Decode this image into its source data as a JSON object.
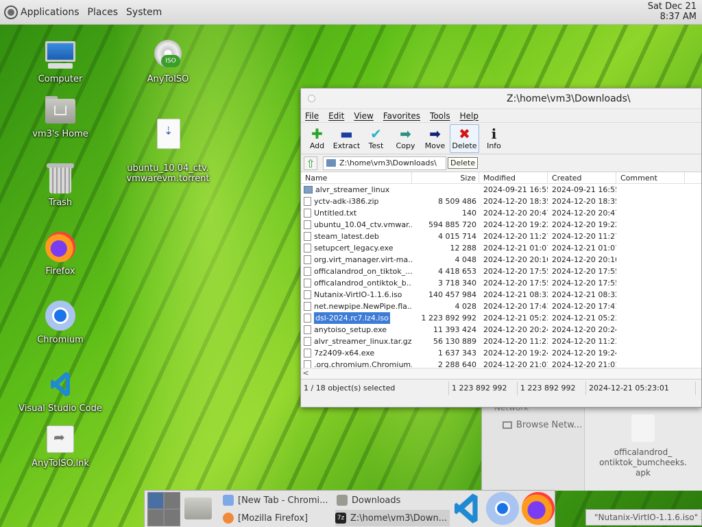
{
  "panel": {
    "menus": [
      "Applications",
      "Places",
      "System"
    ],
    "clock_date": "Sat Dec 21",
    "clock_time": "8:37 AM"
  },
  "desktop": {
    "icons": [
      {
        "label": "Computer",
        "icon": "computer-icon"
      },
      {
        "label": "vm3's Home",
        "icon": "home-folder-icon"
      },
      {
        "label": "Trash",
        "icon": "trash-icon"
      },
      {
        "label": "Firefox",
        "icon": "firefox-icon"
      },
      {
        "label": "Chromium",
        "icon": "chromium-icon"
      },
      {
        "label": "Visual Studio Code",
        "icon": "vscode-icon"
      },
      {
        "label": "AnyToISO.lnk",
        "icon": "shortcut-icon"
      },
      {
        "label": "AnyToISO",
        "icon": "iso-disc-icon"
      },
      {
        "label": "ubuntu_10.04_ctv.\nvmwarevm.torrent",
        "icon": "torrent-file-icon"
      }
    ]
  },
  "background_window": {
    "network_label": "Network",
    "browse_label": "Browse Netw...",
    "apk_label": "officalandrod_\nontiktok_bumcheeks.\napk"
  },
  "bottom_tooltip": "\"Nutanix-VirtIO-1.1.6.iso\" s",
  "file_manager": {
    "title": "Z:\\home\\vm3\\Downloads\\",
    "menu": [
      "File",
      "Edit",
      "View",
      "Favorites",
      "Tools",
      "Help"
    ],
    "toolbar": [
      {
        "label": "Add",
        "glyph": "✚"
      },
      {
        "label": "Extract",
        "glyph": "▬"
      },
      {
        "label": "Test",
        "glyph": "✔"
      },
      {
        "label": "Copy",
        "glyph": "➡"
      },
      {
        "label": "Move",
        "glyph": "➡"
      },
      {
        "label": "Delete",
        "glyph": "✖"
      },
      {
        "label": "Info",
        "glyph": "i"
      }
    ],
    "path": "Z:\\home\\vm3\\Downloads\\",
    "tooltip": "Delete",
    "columns": [
      "Name",
      "Size",
      "Modified",
      "Created",
      "Comment"
    ],
    "files": [
      {
        "name": "alvr_streamer_linux",
        "size": "",
        "modified": "2024-09-21 16:55",
        "created": "2024-09-21 16:55",
        "dir": true
      },
      {
        "name": "yctv-adk-i386.zip",
        "size": "8 509 486",
        "modified": "2024-12-20 18:35",
        "created": "2024-12-20 18:35"
      },
      {
        "name": "Untitled.txt",
        "size": "140",
        "modified": "2024-12-20 20:47",
        "created": "2024-12-20 20:47"
      },
      {
        "name": "ubuntu_10.04_ctv.vmwar...",
        "size": "594 885 720",
        "modified": "2024-12-20 19:22",
        "created": "2024-12-20 19:22"
      },
      {
        "name": "steam_latest.deb",
        "size": "4 015 714",
        "modified": "2024-12-20 11:27",
        "created": "2024-12-20 11:27"
      },
      {
        "name": "setupcert_legacy.exe",
        "size": "12 288",
        "modified": "2024-12-21 01:07",
        "created": "2024-12-21 01:07"
      },
      {
        "name": "org.virt_manager.virt-ma...",
        "size": "4 048",
        "modified": "2024-12-20 20:10",
        "created": "2024-12-20 20:10"
      },
      {
        "name": "officalandrod_on_tiktok_...",
        "size": "4 418 653",
        "modified": "2024-12-20 17:55",
        "created": "2024-12-20 17:55"
      },
      {
        "name": "officalandrod_ontiktok_b...",
        "size": "3 718 340",
        "modified": "2024-12-20 17:55",
        "created": "2024-12-20 17:55"
      },
      {
        "name": "Nutanix-VirtIO-1.1.6.iso",
        "size": "140 457 984",
        "modified": "2024-12-21 08:32",
        "created": "2024-12-21 08:32"
      },
      {
        "name": "net.newpipe.NewPipe.fla...",
        "size": "4 028",
        "modified": "2024-12-20 17:41",
        "created": "2024-12-20 17:41"
      },
      {
        "name": "dsl-2024.rc7.lz4.iso",
        "size": "1 223 892 992",
        "modified": "2024-12-21 05:23",
        "created": "2024-12-21 05:23",
        "selected": true
      },
      {
        "name": "anytoiso_setup.exe",
        "size": "11 393 424",
        "modified": "2024-12-20 20:24",
        "created": "2024-12-20 20:24"
      },
      {
        "name": "alvr_streamer_linux.tar.gz",
        "size": "56 130 889",
        "modified": "2024-12-20 11:23",
        "created": "2024-12-20 11:23"
      },
      {
        "name": "7z2409-x64.exe",
        "size": "1 637 343",
        "modified": "2024-12-20 19:24",
        "created": "2024-12-20 19:24"
      },
      {
        "name": ".org.chromium.Chromium....",
        "size": "2 288 640",
        "modified": "2024-12-20 21:01",
        "created": "2024-12-20 21:01"
      }
    ],
    "status": {
      "selection": "1 / 18 object(s) selected",
      "size": "1 223 892 992",
      "packed": "1 223 892 992",
      "date": "2024-12-21 05:23:01"
    },
    "scroll_left": "<"
  },
  "taskbar": {
    "tasks": [
      {
        "label": "[New Tab - Chromi...",
        "icon": "chromium-small-icon"
      },
      {
        "label": "Downloads",
        "icon": "folder-small-icon"
      },
      {
        "label": "[Mozilla Firefox]",
        "icon": "firefox-small-icon"
      },
      {
        "label": "Z:\\home\\vm3\\Down...",
        "icon": "7zip-small-icon"
      }
    ],
    "sevenzip_badge": "7z"
  },
  "colors": {
    "selection": "#3c7bd6",
    "delete_icon": "#d41414",
    "add_icon": "#27a327"
  }
}
